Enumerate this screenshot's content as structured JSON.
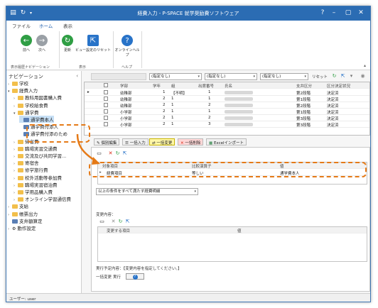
{
  "window": {
    "title": "経費入力 - P-SPACE 就学奨励費ソフトウェア",
    "quick_icon": "↻"
  },
  "menu": {
    "items": [
      "ファイル",
      "ホーム",
      "表示"
    ]
  },
  "ribbon": {
    "groups": [
      {
        "label": "表示履歴ナビゲーション",
        "buttons": [
          "前へ",
          "次へ"
        ]
      },
      {
        "label": "表示",
        "buttons": [
          "更新",
          "ビュー設定のリセット"
        ]
      },
      {
        "label": "ヘルプ",
        "buttons": [
          "オンラインヘルプ"
        ]
      }
    ]
  },
  "nav": {
    "title": "ナビゲーション",
    "items": [
      {
        "label": "学校",
        "level": 0,
        "icon": "folder",
        "expanded": false
      },
      {
        "label": "経費入力",
        "level": 0,
        "icon": "folder",
        "expanded": true
      },
      {
        "label": "教科用図書購入費",
        "level": 1,
        "icon": "folder",
        "expanded": false
      },
      {
        "label": "学校給食費",
        "level": 1,
        "icon": "folder",
        "expanded": false
      },
      {
        "label": "通学費",
        "level": 1,
        "icon": "folder",
        "expanded": true
      },
      {
        "label": "通学費本人",
        "level": 2,
        "icon": "page",
        "selected": true
      },
      {
        "label": "通学費付添人",
        "level": 2,
        "icon": "page"
      },
      {
        "label": "通学費付添のため",
        "level": 2,
        "icon": "page"
      },
      {
        "label": "帰省費",
        "level": 1,
        "icon": "folder"
      },
      {
        "label": "職場実習交通費",
        "level": 1,
        "icon": "folder"
      },
      {
        "label": "交流及び共同学習...",
        "level": 1,
        "icon": "folder"
      },
      {
        "label": "寄宿舎",
        "level": 1,
        "icon": "folder"
      },
      {
        "label": "修学旅行費",
        "level": 1,
        "icon": "folder"
      },
      {
        "label": "校外活動等参加費",
        "level": 1,
        "icon": "folder"
      },
      {
        "label": "職場実習宿泊費",
        "level": 1,
        "icon": "folder"
      },
      {
        "label": "学用品購入費",
        "level": 1,
        "icon": "folder"
      },
      {
        "label": "オンライン学習通信費",
        "level": 1,
        "icon": "folder"
      },
      {
        "label": "支給",
        "level": 0,
        "icon": "folder"
      },
      {
        "label": "帳票出力",
        "level": 0,
        "icon": "folder"
      },
      {
        "label": "支弁額算定",
        "level": 0,
        "icon": "page"
      },
      {
        "label": "動作設定",
        "level": 0,
        "icon": "gear"
      }
    ]
  },
  "filter": {
    "combos": [
      "(指定なし)",
      "(指定なし)",
      "(指定なし)"
    ],
    "reset_label": "リセット"
  },
  "grid": {
    "headers": [
      "学部",
      "学年",
      "組",
      "出席番号",
      "氏名",
      "支弁区分",
      "区分決定状況"
    ],
    "rows": [
      [
        "幼稚部",
        "1",
        "【不明】",
        "1",
        "",
        "第2段階",
        "決定済"
      ],
      [
        "幼稚部",
        "2",
        "1",
        "1",
        "",
        "第1段階",
        "決定済"
      ],
      [
        "幼稚部",
        "2",
        "1",
        "2",
        "",
        "第2段階",
        "決定済"
      ],
      [
        "小学部",
        "2",
        "1",
        "1",
        "",
        "第1段階",
        "決定済"
      ],
      [
        "小学部",
        "2",
        "1",
        "2",
        "",
        "第3段階",
        "決定済"
      ],
      [
        "小学部",
        "2",
        "1",
        "3",
        "",
        "第3段階",
        "決定済"
      ]
    ]
  },
  "tabs": [
    "個別編集",
    "一括入力",
    "一括変更",
    "一括削除",
    "Excelインポート"
  ],
  "condition_grid": {
    "headers": [
      "対象項目",
      "比較演算子",
      "値"
    ],
    "row": [
      "経費項目",
      "等しい",
      "通学費本人"
    ]
  },
  "condition_mode": "以上の条件をすべて満たす経費明細",
  "change_section": {
    "label": "変更内容：",
    "headers": [
      "変更する項目",
      "値"
    ]
  },
  "exec": {
    "label": "実行予定内容：【変更内容を指定してください。】",
    "run_label": "一括変更",
    "run_button": "実行"
  },
  "status": {
    "user": "ユーザー: user"
  }
}
